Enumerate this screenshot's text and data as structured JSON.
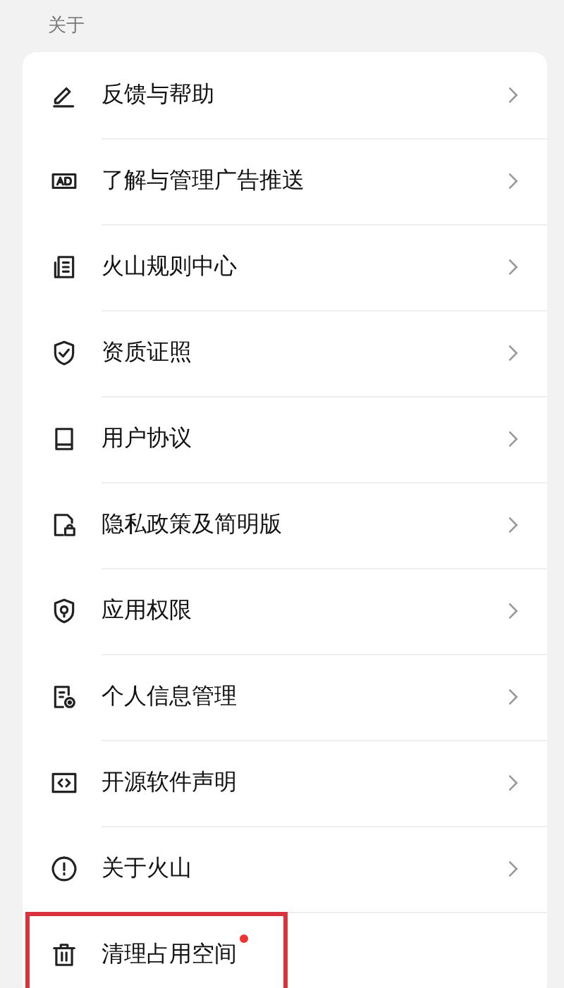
{
  "section_title": "关于",
  "items": [
    {
      "label": "反馈与帮助",
      "badge": false,
      "highlighted": false
    },
    {
      "label": "了解与管理广告推送",
      "badge": false,
      "highlighted": false
    },
    {
      "label": "火山规则中心",
      "badge": false,
      "highlighted": false
    },
    {
      "label": "资质证照",
      "badge": false,
      "highlighted": false
    },
    {
      "label": "用户协议",
      "badge": false,
      "highlighted": false
    },
    {
      "label": "隐私政策及简明版",
      "badge": false,
      "highlighted": false
    },
    {
      "label": "应用权限",
      "badge": false,
      "highlighted": false
    },
    {
      "label": "个人信息管理",
      "badge": false,
      "highlighted": false
    },
    {
      "label": "开源软件声明",
      "badge": false,
      "highlighted": false
    },
    {
      "label": "关于火山",
      "badge": false,
      "highlighted": false
    },
    {
      "label": "清理占用空间",
      "badge": true,
      "highlighted": true
    }
  ]
}
